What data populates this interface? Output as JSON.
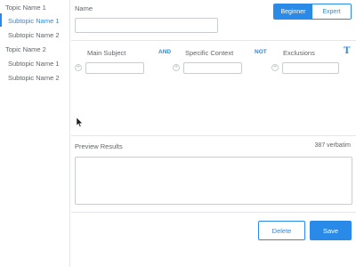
{
  "sidebar": {
    "topics": [
      {
        "label": "Topic Name 1",
        "subtopics": [
          "Subtopic Name 1",
          "Subtopic Name 2"
        ]
      },
      {
        "label": "Topic Name 2",
        "subtopics": [
          "Subtopic Name 1",
          "Subtopic Name 2"
        ]
      }
    ],
    "active_subtopic": "Subtopic Name 1"
  },
  "form": {
    "name_label": "Name",
    "name_value": "",
    "level_toggle": {
      "options": [
        "Beginner",
        "Expert"
      ],
      "selected": "Beginner"
    },
    "columns": {
      "main_subject": "Main Subject",
      "and_op": "AND",
      "specific_context": "Specific Context",
      "not_op": "NOT",
      "exclusions": "Exclusions"
    },
    "preview_label": "Preview Results",
    "count_text": "387 verbatim",
    "delete_label": "Delete",
    "save_label": "Save"
  },
  "colors": {
    "accent": "#2a8ae8",
    "border": "#c9cdd2",
    "text": "#606468"
  },
  "icons": {
    "format": "text-format-icon",
    "add": "plus-circle-icon",
    "cursor": "mouse-pointer-icon"
  }
}
